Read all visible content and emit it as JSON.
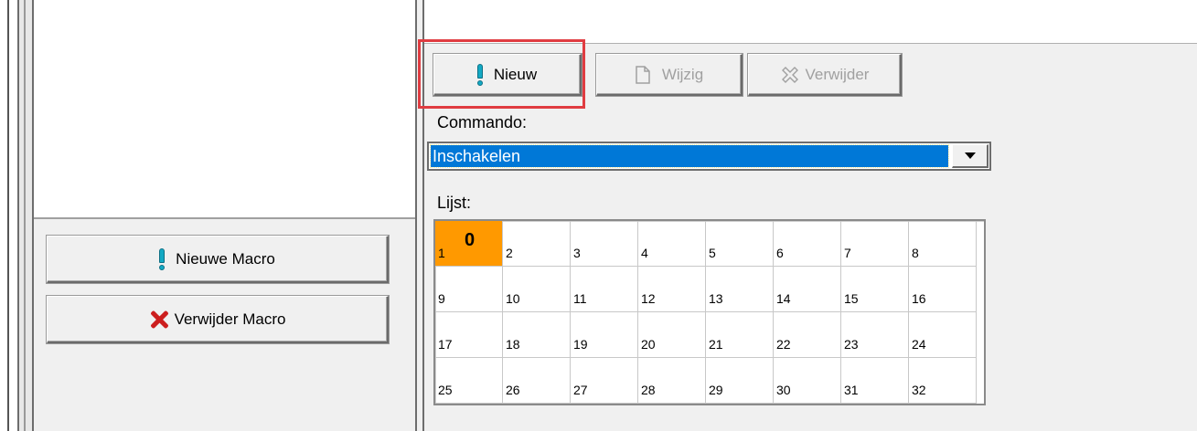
{
  "toolbar": {
    "new_label": "Nieuw",
    "edit_label": "Wijzig",
    "delete_label": "Verwijder"
  },
  "left_panel": {
    "new_macro_label": "Nieuwe Macro",
    "delete_macro_label": "Verwijder Macro"
  },
  "command": {
    "label": "Commando:",
    "selected": "Inschakelen"
  },
  "list": {
    "label": "Lijst:",
    "active_index": 0,
    "active_value": "0",
    "cells": [
      "1",
      "2",
      "3",
      "4",
      "5",
      "6",
      "7",
      "8",
      "9",
      "10",
      "11",
      "12",
      "13",
      "14",
      "15",
      "16",
      "17",
      "18",
      "19",
      "20",
      "21",
      "22",
      "23",
      "24",
      "25",
      "26",
      "27",
      "28",
      "29",
      "30",
      "31",
      "32"
    ]
  },
  "colors": {
    "highlight": "#e03c41",
    "selection": "#0078d7",
    "active_cell": "#ff9900",
    "add_icon": "#13a9c4",
    "delete_icon": "#cc1e1e"
  },
  "icons": {
    "new": "exclamation-icon",
    "edit": "page-icon",
    "delete": "x-outline-icon",
    "new_macro": "exclamation-icon",
    "delete_macro": "red-x-icon"
  }
}
